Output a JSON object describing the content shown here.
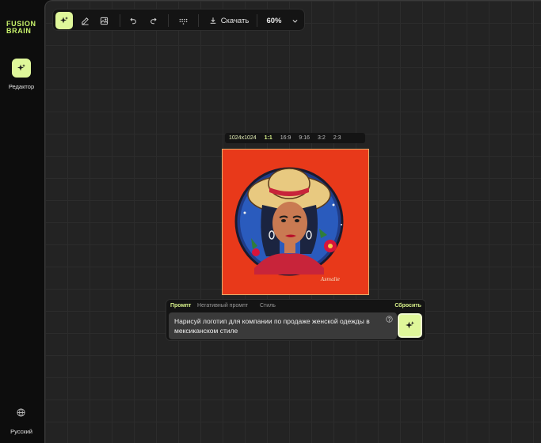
{
  "sidebar": {
    "logo_line1": "FUSION",
    "logo_line2": "BRAIN",
    "editor_label": "Редактор",
    "language_label": "Русский"
  },
  "toolbar": {
    "download_label": "Скачать",
    "zoom": "60%"
  },
  "ratios": {
    "size": "1024x1024",
    "options": [
      "1:1",
      "16:9",
      "9:16",
      "3:2",
      "2:3"
    ],
    "selected": "1:1"
  },
  "image": {
    "signature": "Asmalie"
  },
  "prompt": {
    "tabs": [
      "Промпт",
      "Негативный промпт",
      "Стиль"
    ],
    "active_tab": "Промпт",
    "reset_label": "Сбросить",
    "text": "Нарисуй логотип для компании по продаже женской одежды в мексиканском стиле"
  },
  "colors": {
    "accent": "#dff79a",
    "accent_text": "#c8f26b",
    "background": "#0d0d0d",
    "canvas": "#232323",
    "image_bg": "#e8391a"
  }
}
